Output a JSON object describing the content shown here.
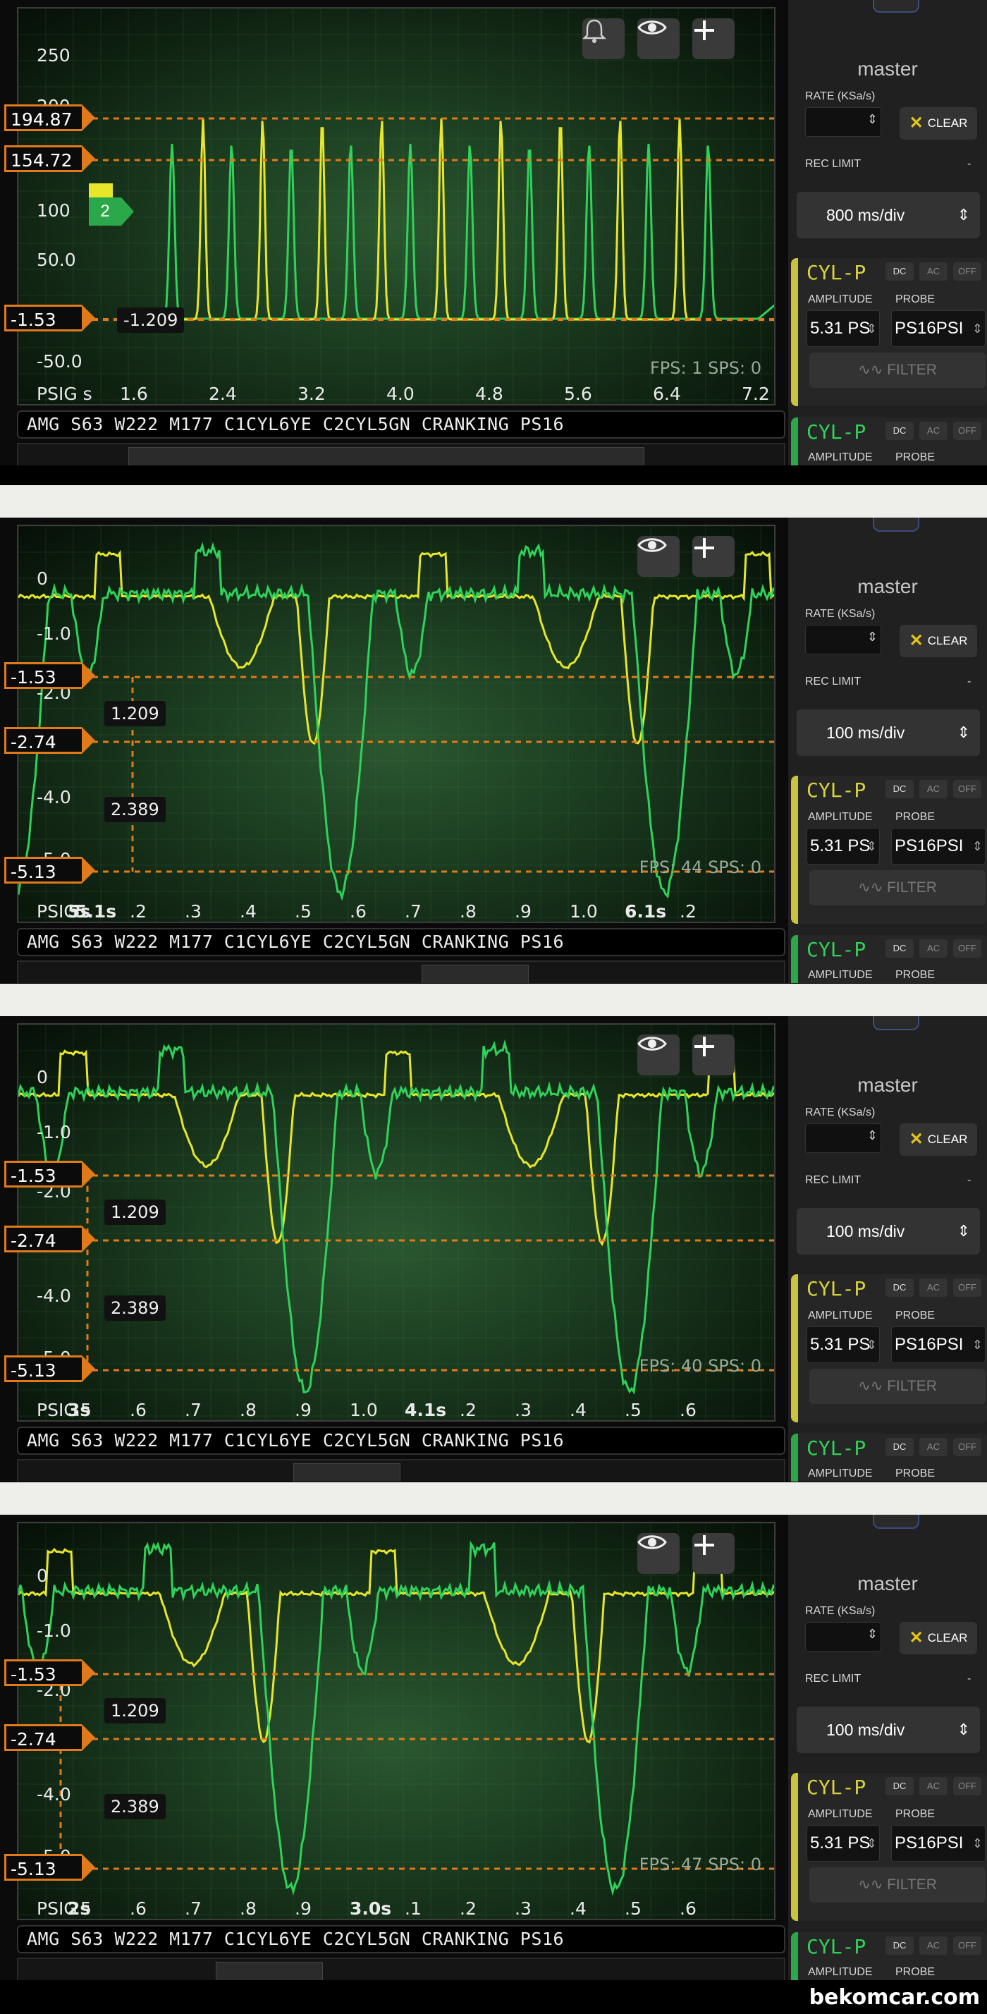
{
  "colors": {
    "yellow_trace": "#e7e62a",
    "green_trace": "#2fd25a",
    "cursor": "#e07a1a",
    "channel_yellow": "#d9d43a",
    "channel_green": "#2ba84a"
  },
  "trace_title": "AMG S63 W222 M177 C1CYL6YE C2CYL5GN CRANKING PS16",
  "icons": [
    "bell-icon",
    "eye-icon",
    "plus-icon",
    "car-icon",
    "chevron-down-icon",
    "close-icon",
    "filter-wave-icon"
  ],
  "side_panel": {
    "master_label": "master",
    "rate_label": "RATE (KSa/s)",
    "clear_label": "CLEAR",
    "rec_limit_label": "REC LIMIT",
    "rec_limit_value": "-",
    "channel_name": "CYL-P",
    "coupling": [
      "DC",
      "AC",
      "OFF"
    ],
    "amplitude_label": "AMPLITUDE",
    "probe_label": "PROBE",
    "amplitude_value": "5.31 PS",
    "probe_value": "PS16PSI",
    "filter_label": "FILTER",
    "cut_amplitude_value": "5.31 PS",
    "cut_probe_value": "PS16PSI"
  },
  "captures": [
    {
      "y_labels": [
        "250",
        "200",
        "100",
        "50.0",
        "-50.0"
      ],
      "cursor_markers": [
        "194.87",
        "154.72",
        "-1.53"
      ],
      "cursor_readout": "-1.209",
      "channel_marker": "2",
      "x_axis_prefix": "PSIG s",
      "x_ticks": [
        "1.6",
        "2.4",
        "3.2",
        "4.0",
        "4.8",
        "5.6",
        "6.4",
        "7.2"
      ],
      "fps_text": "FPS: 1  SPS: 0",
      "timebase": "800 ms/div"
    },
    {
      "y_labels": [
        "0",
        "-1.0",
        "-2.0",
        "-4.0",
        "-5.0"
      ],
      "cursor_markers": [
        "-1.53",
        "-2.74",
        "-5.13"
      ],
      "delta_labels": [
        "1.209",
        "2.389"
      ],
      "x_axis_prefix": "PSIG",
      "x_ticks": [
        "5s",
        "5.1s",
        ".2",
        ".3",
        ".4",
        ".5",
        ".6",
        ".7",
        ".8",
        ".9",
        "1.0",
        "6.1s",
        ".2"
      ],
      "fps_text": "FPS: 44  SPS: 0",
      "timebase": "100 ms/div"
    },
    {
      "y_labels": [
        "0",
        "-1.0",
        "-2.0",
        "-4.0",
        "-5.0"
      ],
      "cursor_markers": [
        "-1.53",
        "-2.74",
        "-5.13"
      ],
      "delta_labels": [
        "1.209",
        "2.389"
      ],
      "x_axis_prefix": "PSIG",
      "x_ticks": [
        "3s",
        ".5",
        ".6",
        ".7",
        ".8",
        ".9",
        "1.0",
        "4.1s",
        ".2",
        ".3",
        ".4",
        ".5",
        ".6"
      ],
      "fps_text": "FPS: 40  SPS: 0",
      "timebase": "100 ms/div"
    },
    {
      "y_labels": [
        "0",
        "-1.0",
        "-2.0",
        "-4.0",
        "-5.0"
      ],
      "cursor_markers": [
        "-1.53",
        "-2.74",
        "-5.13"
      ],
      "delta_labels": [
        "1.209",
        "2.389"
      ],
      "x_axis_prefix": "PSIG",
      "x_ticks": [
        "2s",
        ".5",
        ".6",
        ".7",
        ".8",
        ".9",
        "3.0s",
        ".1",
        ".2",
        ".3",
        ".4",
        ".5",
        ".6"
      ],
      "fps_text": "FPS: 47  SPS: 0",
      "timebase": "100 ms/div"
    }
  ],
  "watermark": "bekomcar.com"
}
